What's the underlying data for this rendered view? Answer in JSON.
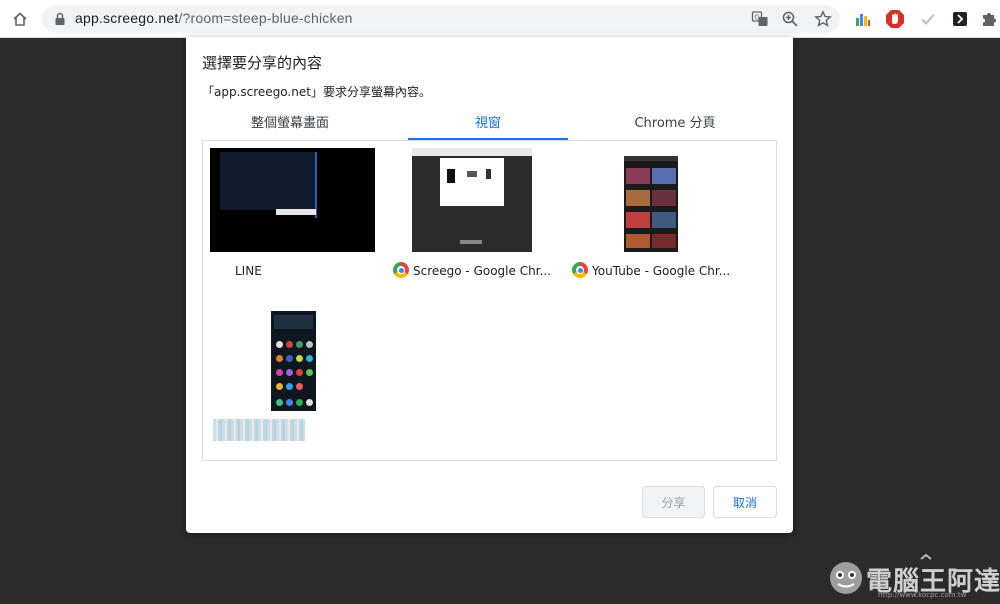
{
  "browser": {
    "url_host": "app.screego.net",
    "url_path": "/?room=steep-blue-chicken"
  },
  "dialog": {
    "title": "選擇要分享的內容",
    "description": "「app.screego.net」要求分享螢幕內容。",
    "tabs": [
      {
        "label": "整個螢幕畫面",
        "active": false
      },
      {
        "label": "視窗",
        "active": true
      },
      {
        "label": "Chrome 分頁",
        "active": false
      }
    ],
    "sources": [
      {
        "label": "LINE",
        "icon": "line-window"
      },
      {
        "label": "Screego - Google Chr...",
        "icon": "chrome-icon"
      },
      {
        "label": "YouTube - Google Chr...",
        "icon": "chrome-icon"
      }
    ],
    "share_label": "分享",
    "cancel_label": "取消"
  },
  "watermark": {
    "text": "電腦王阿達",
    "url": "http://www.kocpc.com.tw"
  },
  "colors": {
    "accent": "#1a73e8",
    "background": "#2b2b2b"
  }
}
